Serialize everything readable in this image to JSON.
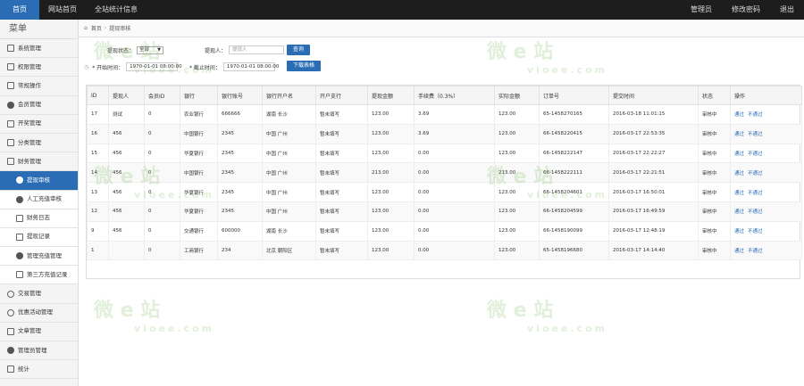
{
  "topnav": {
    "left": [
      "首页",
      "网站首页",
      "全站统计信息"
    ],
    "right": [
      "管理员",
      "修改密码",
      "退出"
    ]
  },
  "sidebar": {
    "title": "菜单",
    "items": [
      {
        "label": "系统管理",
        "icon": "grid-icon"
      },
      {
        "label": "权限管理",
        "icon": "gear-icon"
      },
      {
        "label": "常规操作",
        "icon": "gear-icon"
      },
      {
        "label": "会员管理",
        "icon": "user-icon"
      },
      {
        "label": "开奖管理",
        "icon": "gear-icon"
      },
      {
        "label": "分类管理",
        "icon": "gear-icon"
      },
      {
        "label": "财务管理",
        "icon": "gear-icon"
      }
    ],
    "subitems": [
      {
        "label": "提现审核",
        "icon": "circle-icon"
      },
      {
        "label": "人工充值审核",
        "icon": "user-icon"
      },
      {
        "label": "财务日志",
        "icon": "document-icon"
      },
      {
        "label": "提现记录",
        "icon": "shield-icon"
      },
      {
        "label": "管理充值管理",
        "icon": "user-icon"
      },
      {
        "label": "第三方充值记录",
        "icon": "document-icon"
      }
    ],
    "items_after": [
      {
        "label": "交易管理",
        "icon": "circle-icon"
      },
      {
        "label": "优惠活动管理",
        "icon": "circle-icon"
      },
      {
        "label": "文章管理",
        "icon": "document-icon"
      },
      {
        "label": "管理员管理",
        "icon": "user-icon"
      },
      {
        "label": "统计",
        "icon": "chart-icon"
      }
    ]
  },
  "breadcrumb": {
    "home": "首页",
    "current": "提现审核"
  },
  "filters": {
    "status_label": "提现状态：",
    "status_value": "全部",
    "applicant_label": "提现人：",
    "applicant_placeholder": "提现人",
    "query_button": "查询",
    "start_label": "* 开始时间：",
    "start_value": "1970-01-01 08:00:00",
    "end_label": "* 截止时间：",
    "end_value": "1970-01-01 08:00:00",
    "export_button": "下载表格"
  },
  "table": {
    "headers": [
      "ID",
      "提现人",
      "会员ID",
      "银行",
      "银行账号",
      "银行开户名",
      "开户支行",
      "提现金额",
      "手续费（0.3%）",
      "实际金额",
      "订单号",
      "提交时间",
      "状态",
      "操作"
    ],
    "rows": [
      [
        "17",
        "测试",
        "0",
        "农业银行",
        "666666",
        "湖南 长沙",
        "暂未填写",
        "123.00",
        "3.69",
        "123.00",
        "65-1458270165",
        "2016-03-18 11:01:15",
        "审核中",
        "通过",
        "不通过"
      ],
      [
        "16",
        "456",
        "0",
        "中国银行",
        "2345",
        "中国 广州",
        "暂未填写",
        "123.00",
        "3.69",
        "123.00",
        "66-1458220415",
        "2016-03-17 22:53:35",
        "审核中",
        "通过",
        "不通过"
      ],
      [
        "15",
        "456",
        "0",
        "华夏银行",
        "2345",
        "中国 广州",
        "暂未填写",
        "123.00",
        "0.00",
        "123.00",
        "66-1458222147",
        "2016-03-17 22:22:27",
        "审核中",
        "通过",
        "不通过"
      ],
      [
        "14",
        "456",
        "0",
        "中国银行",
        "2345",
        "中国 广州",
        "暂未填写",
        "213.00",
        "0.00",
        "213.00",
        "66-1458222111",
        "2016-03-17 22:21:51",
        "审核中",
        "通过",
        "不通过"
      ],
      [
        "13",
        "456",
        "0",
        "华夏银行",
        "2345",
        "中国 广州",
        "暂未填写",
        "123.00",
        "0.00",
        "123.00",
        "66-1458204601",
        "2016-03-17 16:50:01",
        "审核中",
        "通过",
        "不通过"
      ],
      [
        "12",
        "456",
        "0",
        "华夏银行",
        "2345",
        "中国 广州",
        "暂未填写",
        "123.00",
        "0.00",
        "123.00",
        "66-1458204599",
        "2016-03-17 16:49:59",
        "审核中",
        "通过",
        "不通过"
      ],
      [
        "9",
        "456",
        "0",
        "交通银行",
        "600000",
        "湖南 长沙",
        "暂未填写",
        "123.00",
        "0.00",
        "123.00",
        "66-1458190099",
        "2016-03-17 12:48:19",
        "审核中",
        "通过",
        "不通过"
      ],
      [
        "1",
        "",
        "0",
        "工商银行",
        "234",
        "北京 朝阳区",
        "暂未填写",
        "123.00",
        "0.00",
        "123.00",
        "65-1458196680",
        "2016-03-17 14:14:40",
        "审核中",
        "通过",
        "不通过"
      ]
    ]
  },
  "watermark": {
    "text": "微 e 站",
    "url": "vioee.com",
    "color": "#78b45a"
  },
  "colors": {
    "accent": "#2a6db5",
    "topbar": "#1d1d1d"
  }
}
